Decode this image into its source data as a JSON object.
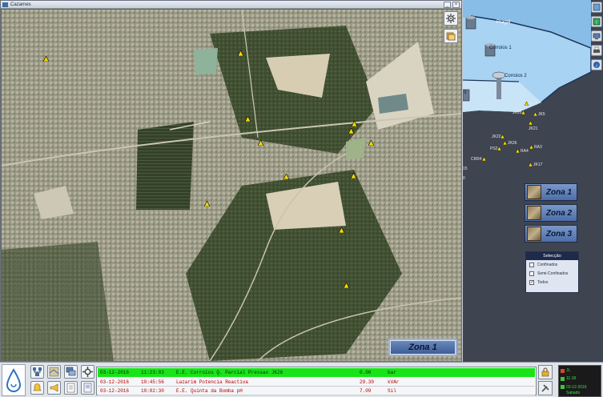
{
  "window": {
    "title": "Cazarnes"
  },
  "map_tools": {
    "settings_icon": "gear-icon",
    "layers_icon": "layers-icon"
  },
  "map_pins": 12,
  "zona_map_button": "Zona 1",
  "overview": {
    "zones": [
      "Pragal",
      "Corroios 1",
      "Corroios 2",
      "3"
    ],
    "wells": [
      "RA2",
      "JK23",
      "JK5",
      "JK21",
      "JK22",
      "JK26",
      "PS2",
      "RA3",
      "RA4",
      "CRR4",
      "JK17"
    ],
    "edge_labels": [
      "15",
      "0"
    ]
  },
  "zona_buttons": [
    "Zona 1",
    "Zona 2",
    "Zona 3"
  ],
  "selection": {
    "title": "Selecção",
    "options": [
      {
        "label": "Confinados",
        "checked": false
      },
      {
        "label": "Semi-Confinados",
        "checked": false
      },
      {
        "label": "Todos",
        "checked": true
      }
    ]
  },
  "alarms": [
    {
      "date": "03-12-2016",
      "time": "11:23:03",
      "description": "E.E. Corroios Q. Parcial Pressao JK26",
      "value": "0.00",
      "unit": "bar",
      "state": "active"
    },
    {
      "date": "03-12-2016",
      "time": "10:45:56",
      "description": "Lazarim Potencia Reactiva",
      "value": "29.30",
      "unit": "kVAr",
      "state": "ack"
    },
    {
      "date": "03-12-2016",
      "time": "10:02:30",
      "description": "E.E. Quinta da Bomba pH",
      "value": "7.09",
      "unit": "Sil",
      "state": "ack"
    }
  ],
  "status": {
    "line1": "JL",
    "time": "11:18",
    "date": "03-12-2016",
    "day": "Sabado"
  },
  "colors": {
    "alarm_active": "#18e418",
    "alarm_ack_text": "#b30000",
    "zone_button": "#4c6ea8"
  }
}
